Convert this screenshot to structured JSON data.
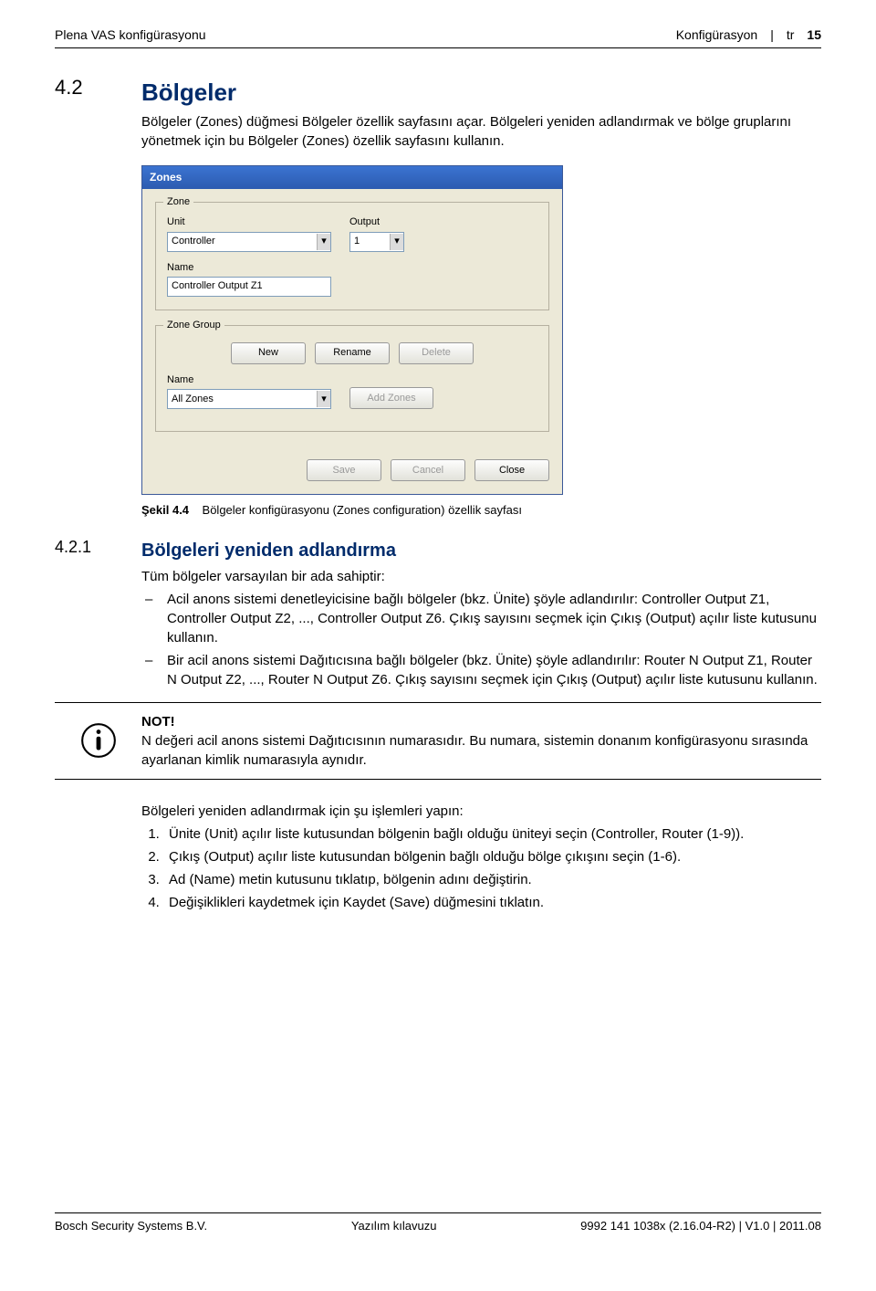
{
  "header": {
    "left": "Plena VAS konfigürasyonu",
    "right_section": "Konfigürasyon",
    "right_lang": "tr",
    "page_num": "15"
  },
  "sec42": {
    "num": "4.2",
    "title": "Bölgeler",
    "p1": "Bölgeler (Zones) düğmesi Bölgeler özellik sayfasını açar. Bölgeleri yeniden adlandırmak ve bölge gruplarını yönetmek için bu Bölgeler (Zones) özellik sayfasını kullanın."
  },
  "screenshot": {
    "title": "Zones",
    "grp_zone": "Zone",
    "lbl_unit": "Unit",
    "val_unit": "Controller",
    "lbl_output": "Output",
    "val_output": "1",
    "lbl_name": "Name",
    "val_name": "Controller Output Z1",
    "grp_zonegroup": "Zone Group",
    "btn_new": "New",
    "btn_rename": "Rename",
    "btn_delete": "Delete",
    "lbl_name2": "Name",
    "val_name2": "All Zones",
    "btn_addzones": "Add Zones",
    "btn_save": "Save",
    "btn_cancel": "Cancel",
    "btn_close": "Close"
  },
  "caption44": {
    "label": "Şekil 4.4",
    "text": "Bölgeler konfigürasyonu (Zones configuration) özellik sayfası"
  },
  "sec421": {
    "num": "4.2.1",
    "title": "Bölgeleri yeniden adlandırma",
    "intro": "Tüm bölgeler varsayılan bir ada sahiptir:",
    "li1": "Acil anons sistemi denetleyicisine bağlı bölgeler (bkz. Ünite) şöyle adlandırılır: Controller Output Z1, Controller Output Z2, ..., Controller Output Z6. Çıkış sayısını seçmek için Çıkış (Output) açılır liste kutusunu kullanın.",
    "li2": "Bir acil anons sistemi Dağıtıcısına bağlı bölgeler (bkz. Ünite) şöyle adlandırılır: Router N Output Z1, Router N Output Z2, ..., Router N Output Z6. Çıkış sayısını seçmek için Çıkış (Output) açılır liste kutusunu kullanın."
  },
  "note": {
    "label": "NOT!",
    "text": "N değeri acil anons sistemi Dağıtıcısının numarasıdır. Bu numara, sistemin donanım konfigürasyonu sırasında ayarlanan kimlik numarasıyla aynıdır."
  },
  "steps": {
    "intro": "Bölgeleri yeniden adlandırmak için şu işlemleri yapın:",
    "s1": "Ünite (Unit) açılır liste kutusundan bölgenin bağlı olduğu üniteyi seçin (Controller, Router (1-9)).",
    "s2": "Çıkış (Output) açılır liste kutusundan bölgenin bağlı olduğu bölge çıkışını seçin (1-6).",
    "s3": "Ad (Name) metin kutusunu tıklatıp, bölgenin adını değiştirin.",
    "s4": "Değişiklikleri kaydetmek için Kaydet (Save) düğmesini tıklatın."
  },
  "footer": {
    "left": "Bosch Security Systems B.V.",
    "center": "Yazılım kılavuzu",
    "right": "9992 141 1038x  (2.16.04-R2) | V1.0 | 2011.08"
  }
}
